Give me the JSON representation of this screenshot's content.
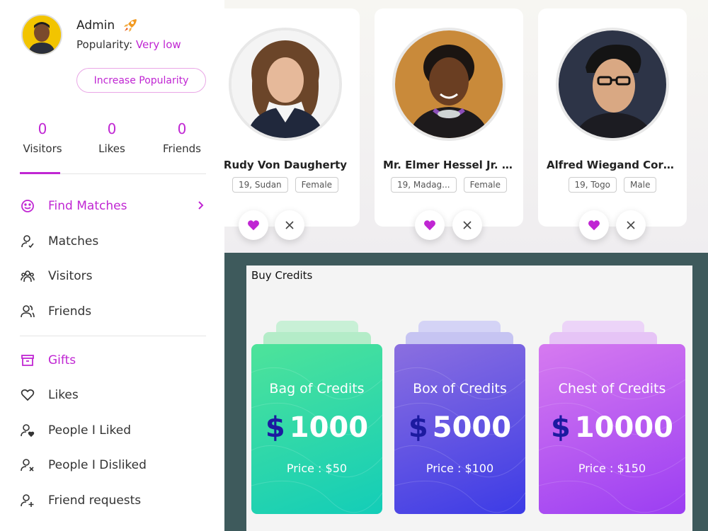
{
  "profile": {
    "name": "Admin",
    "popularity_label": "Popularity:",
    "popularity_value": "Very low",
    "increase_button": "Increase Popularity"
  },
  "stats": [
    {
      "value": "0",
      "label": "Visitors"
    },
    {
      "value": "0",
      "label": "Likes"
    },
    {
      "value": "0",
      "label": "Friends"
    }
  ],
  "menu": {
    "group1": [
      {
        "label": "Find Matches",
        "icon": "smile-icon",
        "active": true
      },
      {
        "label": "Matches",
        "icon": "user-check-icon"
      },
      {
        "label": "Visitors",
        "icon": "users-icon"
      },
      {
        "label": "Friends",
        "icon": "friends-icon"
      }
    ],
    "group2": [
      {
        "label": "Gifts",
        "icon": "gift-box-icon",
        "active": true
      },
      {
        "label": "Likes",
        "icon": "heart-outline-icon"
      },
      {
        "label": "People I Liked",
        "icon": "user-heart-icon"
      },
      {
        "label": "People I Disliked",
        "icon": "user-x-icon"
      },
      {
        "label": "Friend requests",
        "icon": "user-plus-icon"
      }
    ]
  },
  "matches": [
    {
      "name": "Rudy Von Daugherty",
      "age_location": "19, Sudan",
      "gender": "Female"
    },
    {
      "name": "Mr. Elmer Hessel Jr. W...",
      "age_location": "19, Madag...",
      "gender": "Female"
    },
    {
      "name": "Alfred Wiegand Cormi...",
      "age_location": "19, Togo",
      "gender": "Male"
    }
  ],
  "credits": {
    "title": "Buy Credits",
    "packages": [
      {
        "name": "Bag of Credits",
        "amount": "1000",
        "price": "Price : $50",
        "color_from": "#4ee39a",
        "color_to": "#13cdb8"
      },
      {
        "name": "Box of Credits",
        "amount": "5000",
        "price": "Price : $100",
        "color_from": "#8b6fe0",
        "color_to": "#3c3be6"
      },
      {
        "name": "Chest of Credits",
        "amount": "10000",
        "price": "Price : $150",
        "color_from": "#d67af0",
        "color_to": "#9b3ef2"
      }
    ]
  },
  "colors": {
    "accent": "#c026d3",
    "panel_bg": "#3e5a5c"
  }
}
